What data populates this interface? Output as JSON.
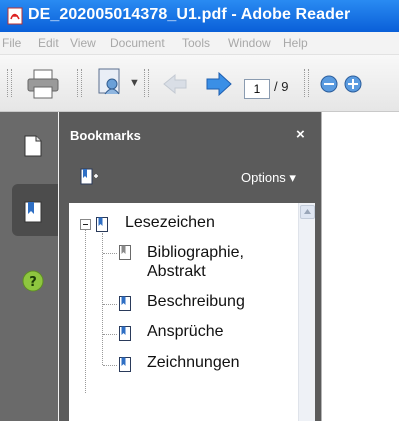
{
  "window": {
    "title": "DE_202005014378_U1.pdf - Adobe Reader"
  },
  "menu": [
    "File",
    "Edit",
    "View",
    "Document",
    "Tools",
    "Window",
    "Help"
  ],
  "toolbar": {
    "page_current": "1",
    "page_total": "/ 9"
  },
  "bookmarks_panel": {
    "header": "Bookmarks",
    "close_label": "×",
    "options_label": "Options ▾",
    "root": "Lesezeichen",
    "items": [
      {
        "label_lines": [
          "Bibliographie,",
          "Abstrakt"
        ]
      },
      {
        "label": "Beschreibung"
      },
      {
        "label": "Ansprüche"
      },
      {
        "label": "Zeichnungen"
      }
    ]
  },
  "colors": {
    "titlebar": "#0a5fd8",
    "nav_panel": "#6a6a6a",
    "bookmark_panel": "#5b5b5b",
    "help_icon": "#8ec63f"
  }
}
